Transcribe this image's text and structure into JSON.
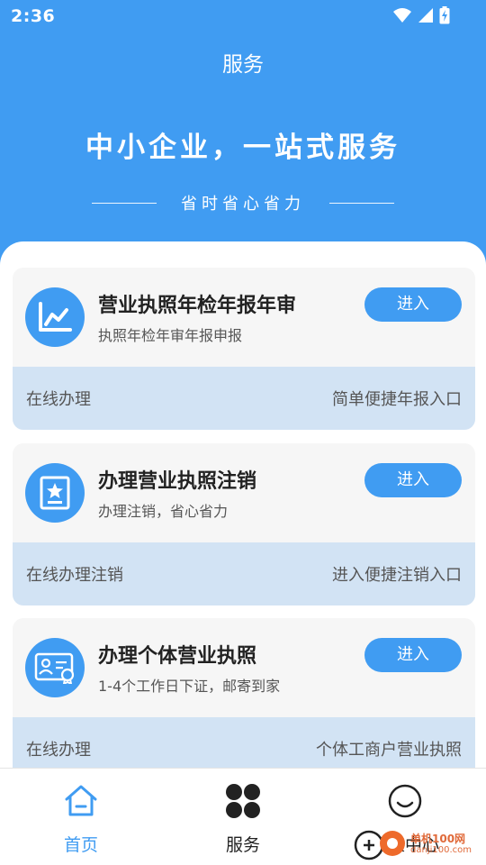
{
  "status_bar": {
    "time": "2:36"
  },
  "header": {
    "title": "服务",
    "heading": "中小企业，一站式服务",
    "subheading": "省时省心省力"
  },
  "cards": [
    {
      "title": "营业执照年检年报年审",
      "subtitle": "执照年检年审年报申报",
      "button": "进入",
      "foot_left": "在线办理",
      "foot_right": "简单便捷年报入口",
      "icon": "chart-icon"
    },
    {
      "title": "办理营业执照注销",
      "subtitle": "办理注销，省心省力",
      "button": "进入",
      "foot_left": "在线办理注销",
      "foot_right": "进入便捷注销入口",
      "icon": "certificate-icon"
    },
    {
      "title": "办理个体营业执照",
      "subtitle": "1-4个工作日下证，邮寄到家",
      "button": "进入",
      "foot_left": "在线办理",
      "foot_right": "个体工商户营业执照",
      "icon": "id-card-icon"
    }
  ],
  "bottom_nav": {
    "items": [
      {
        "label": "首页",
        "icon": "home-icon",
        "active": true
      },
      {
        "label": "服务",
        "icon": "grid-icon",
        "active": false
      },
      {
        "label": "个人中心",
        "icon": "smiley-icon",
        "active": false
      }
    ]
  },
  "watermark": {
    "text": "单机100网",
    "url": "danji100.com"
  },
  "colors": {
    "primary": "#409cf2",
    "card_footer": "#d2e3f4",
    "card_bg": "#f6f6f6"
  }
}
